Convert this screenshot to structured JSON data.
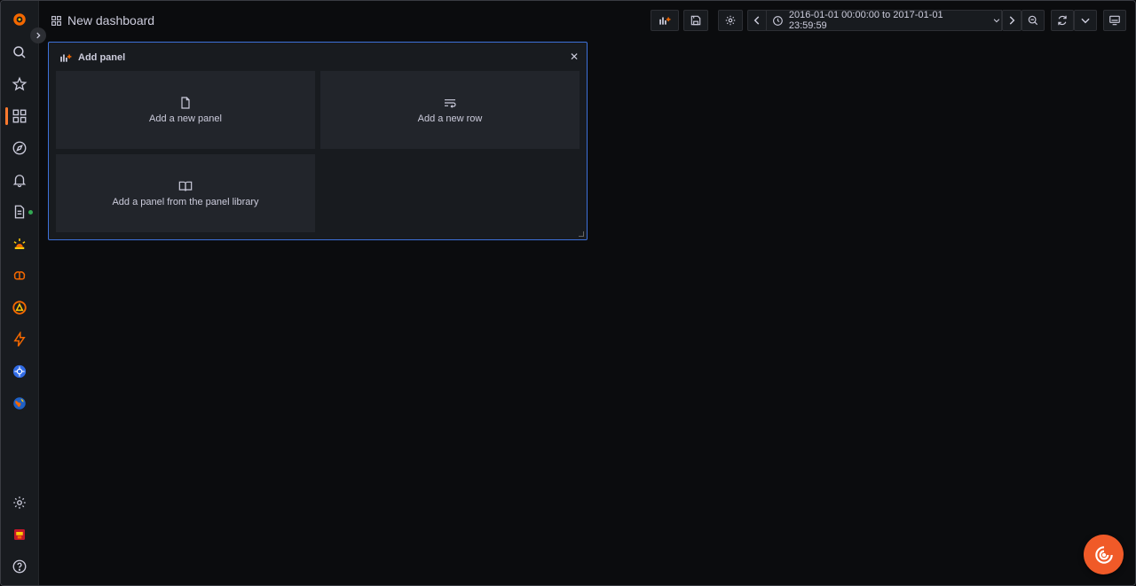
{
  "header": {
    "title": "New dashboard",
    "time_range": "2016-01-01 00:00:00 to 2017-01-01 23:59:59"
  },
  "add_panel": {
    "title": "Add panel",
    "options": [
      {
        "label": "Add a new panel",
        "icon": "file-icon"
      },
      {
        "label": "Add a new row",
        "icon": "row-icon"
      },
      {
        "label": "Add a panel from the panel library",
        "icon": "book-open-icon"
      }
    ]
  },
  "sidebar": {
    "items": [
      {
        "name": "grafana-logo",
        "icon": "grafana-logo"
      },
      {
        "name": "search",
        "icon": "search-icon"
      },
      {
        "name": "starred",
        "icon": "star-icon"
      },
      {
        "name": "dashboards",
        "icon": "apps-icon",
        "active": true
      },
      {
        "name": "explore",
        "icon": "compass-icon"
      },
      {
        "name": "alerting",
        "icon": "bell-icon"
      },
      {
        "name": "reports",
        "icon": "file-alt-icon"
      },
      {
        "name": "incident",
        "icon": "siren-icon"
      },
      {
        "name": "machine-learning",
        "icon": "brain-icon"
      },
      {
        "name": "oncall",
        "icon": "oncall-icon"
      },
      {
        "name": "performance",
        "icon": "bolt-icon"
      },
      {
        "name": "kubernetes",
        "icon": "kubernetes-icon"
      },
      {
        "name": "synthetic-monitoring",
        "icon": "globe-icon"
      },
      {
        "name": "configuration",
        "icon": "gear-icon"
      },
      {
        "name": "profile",
        "icon": "avatar-icon"
      },
      {
        "name": "help",
        "icon": "question-circle-icon"
      }
    ]
  },
  "colors": {
    "accent": "#ff7a2e",
    "focus_border": "#3d71d9",
    "background": "#0b0c0e",
    "panel": "#181b1f",
    "card": "#22252b"
  }
}
